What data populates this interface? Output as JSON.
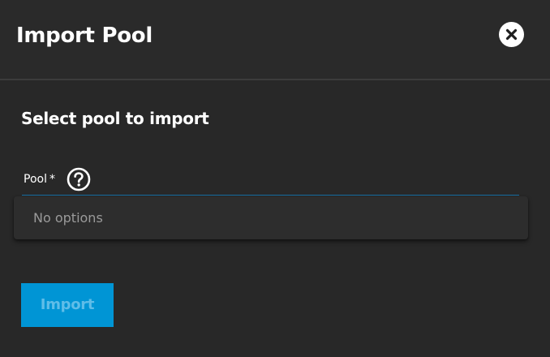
{
  "dialog": {
    "title": "Import Pool",
    "close_icon": "close-icon"
  },
  "form": {
    "section_title": "Select pool to import",
    "pool_field": {
      "label": "Pool",
      "required_marker": "*",
      "help_icon": "help-circle-icon",
      "dropdown_empty_text": "No options"
    }
  },
  "actions": {
    "import_label": "Import",
    "import_disabled": true
  },
  "colors": {
    "background": "#282828",
    "accent": "#0095d5",
    "underline": "#1a73a8"
  }
}
